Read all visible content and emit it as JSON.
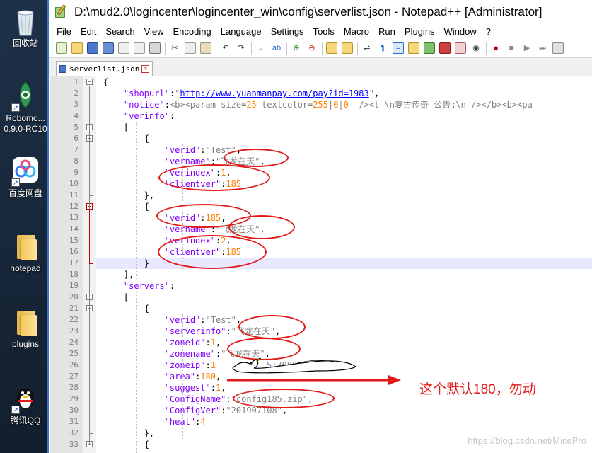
{
  "desktop": {
    "icons": [
      {
        "label": "回收站",
        "icon": "recycle-bin-icon"
      },
      {
        "label": "Robomo...\n0.9.0-RC10",
        "icon": "robomongo-icon"
      },
      {
        "label": "百度网盘",
        "icon": "baidu-netdisk-icon"
      },
      {
        "label": "notepad",
        "icon": "folder-icon"
      },
      {
        "label": "plugins",
        "icon": "folder-icon"
      },
      {
        "label": "腾讯QQ",
        "icon": "qq-penguin-icon"
      }
    ]
  },
  "window": {
    "title": "D:\\mud2.0\\logincenter\\logincenter_win\\config\\serverlist.json - Notepad++ [Administrator]",
    "menus": [
      "File",
      "Edit",
      "Search",
      "View",
      "Encoding",
      "Language",
      "Settings",
      "Tools",
      "Macro",
      "Run",
      "Plugins",
      "Window",
      "?"
    ],
    "tab_label": "serverlist.json"
  },
  "editor": {
    "lines": [
      "{",
      "    \"shopurl\":\"http://www.yuanmanpay.com/pay?id=1983\",",
      "    \"notice\":\"<b><param size=25 textcolor=255|0|0  /><t \\n复古传奇 公告:\\n /></b><b><pa",
      "    \"verinfo\":",
      "    [",
      "        {",
      "            \"verid\":\"Test\",",
      "            \"vername\":\"飞龙在天\",",
      "            \"verindex\":1,",
      "            \"clientver\":185",
      "        },",
      "        {",
      "            \"verid\":185,",
      "            \"vername\":\"飞龙在天\",",
      "            \"verindex\":2,",
      "            \"clientver\":185",
      "        }",
      "    ],",
      "    \"servers\":",
      "    [",
      "        {",
      "            \"verid\":\"Test\",",
      "            \"serverinfo\":\"飞龙在天\",",
      "            \"zoneid\":1,",
      "            \"zonename\":\"飞龙在天\",",
      "            \"zoneip\":\"1",
      "            \"area\":180,",
      "            \"suggest\":1,",
      "            \"ConfigName\":\"config185.zip\",",
      "            \"ConfigVer\":\"201907108\",",
      "            \"heat\":4",
      "        },",
      "        {"
    ],
    "zoneip_tail": "5:7000\","
  },
  "annotation": {
    "note": "这个默认180，勿动",
    "color": "#e21a1a"
  },
  "watermark": "https://blog.csdn.net/MicePro"
}
